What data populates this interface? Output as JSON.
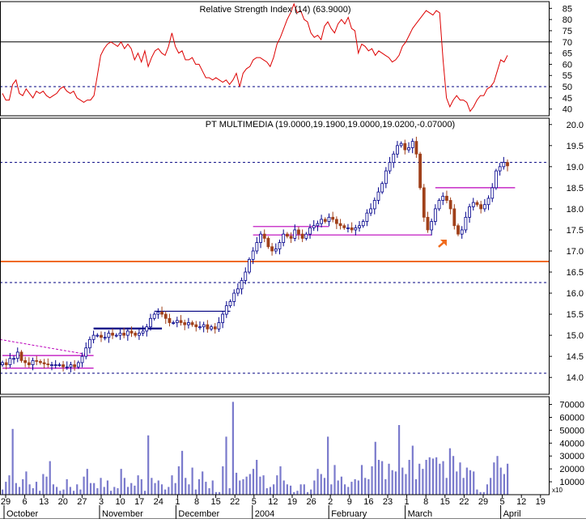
{
  "chart_data": [
    {
      "type": "line",
      "panel": "indicator",
      "title": "Relative Strength Index (14) (63.9000)",
      "y_ticks": [
        40,
        45,
        50,
        55,
        60,
        65,
        70,
        75,
        80,
        85
      ],
      "ylim": [
        37,
        88
      ],
      "reference_lines": [
        {
          "y": 70,
          "style": "solid"
        },
        {
          "y": 50,
          "style": "dashed"
        }
      ],
      "series": [
        {
          "color": "#dd0000",
          "values": [
            47,
            44,
            44,
            51,
            53,
            47,
            46,
            49,
            47,
            45,
            48,
            47,
            48,
            46,
            45,
            46,
            47,
            49,
            50,
            48,
            47,
            48,
            45,
            44,
            43,
            44,
            44,
            46,
            55,
            64,
            67,
            69,
            70,
            69,
            68,
            70,
            67,
            69,
            67,
            62,
            65,
            61,
            66,
            59,
            63,
            66,
            67,
            65,
            64,
            68,
            74,
            68,
            65,
            66,
            62,
            62,
            63,
            60,
            60,
            57,
            54,
            54,
            53,
            54,
            53,
            52,
            53,
            51,
            53,
            56,
            50,
            56,
            58,
            59,
            62,
            63,
            63,
            62,
            61,
            59,
            63,
            69,
            72,
            76,
            80,
            83,
            87,
            83,
            84,
            80,
            79,
            74,
            72,
            73,
            71,
            77,
            79,
            76,
            74,
            78,
            80,
            78,
            81,
            76,
            75,
            65,
            69,
            68,
            66,
            67,
            64,
            66,
            65,
            64,
            63,
            61,
            62,
            64,
            68,
            70,
            73,
            76,
            78,
            80,
            82,
            84,
            83,
            82,
            84,
            83,
            62,
            45,
            41,
            44,
            46,
            44,
            44,
            43,
            39,
            41,
            44,
            46,
            46,
            49,
            50,
            52,
            57,
            62,
            61,
            64
          ]
        }
      ]
    },
    {
      "type": "candlestick",
      "panel": "price",
      "title": "PT MULTIMEDIA (19.0000,19.1900,19.0000,19.0200,-0.07000)",
      "y_ticks": [
        14.0,
        14.5,
        15.0,
        15.5,
        16.0,
        16.5,
        17.0,
        17.5,
        18.0,
        18.5,
        19.0,
        19.5,
        20.0
      ],
      "ylim": [
        13.6,
        20.15
      ],
      "reference_lines": [
        {
          "y": 16.75,
          "style": "thick",
          "color": "#f06a1c"
        },
        {
          "y": 19.1,
          "style": "dashed"
        },
        {
          "y": 16.25,
          "style": "dashed"
        },
        {
          "y": 14.1,
          "style": "dashed"
        }
      ],
      "close": [
        14.35,
        14.3,
        14.45,
        14.45,
        14.6,
        14.4,
        14.35,
        14.3,
        14.4,
        14.38,
        14.35,
        14.32,
        14.3,
        14.3,
        14.3,
        14.3,
        14.25,
        14.25,
        14.3,
        14.25,
        14.35,
        14.5,
        14.7,
        14.9,
        15.0,
        15.0,
        14.95,
        14.95,
        15.05,
        15.0,
        15.0,
        15.05,
        15.0,
        15.1,
        15.05,
        15.0,
        15.05,
        15.1,
        15.2,
        15.4,
        15.5,
        15.55,
        15.5,
        15.4,
        15.3,
        15.3,
        15.35,
        15.3,
        15.25,
        15.3,
        15.25,
        15.2,
        15.2,
        15.25,
        15.15,
        15.2,
        15.15,
        15.3,
        15.5,
        15.7,
        15.8,
        16.0,
        16.1,
        16.3,
        16.5,
        16.8,
        17.0,
        17.2,
        17.4,
        17.3,
        17.1,
        17.0,
        17.05,
        17.2,
        17.4,
        17.35,
        17.3,
        17.5,
        17.4,
        17.3,
        17.4,
        17.55,
        17.6,
        17.65,
        17.75,
        17.7,
        17.8,
        17.75,
        17.65,
        17.6,
        17.55,
        17.55,
        17.5,
        17.55,
        17.6,
        17.7,
        17.9,
        18.0,
        18.2,
        18.4,
        18.6,
        18.9,
        19.1,
        19.3,
        19.5,
        19.55,
        19.4,
        19.45,
        19.6,
        19.3,
        18.5,
        17.8,
        17.5,
        17.7,
        18.0,
        18.2,
        18.3,
        18.2,
        18.0,
        17.6,
        17.4,
        17.5,
        17.8,
        18.05,
        18.15,
        18.1,
        18.0,
        18.1,
        18.25,
        18.5,
        18.9,
        19.0,
        19.1,
        19.02
      ],
      "annotations": [
        {
          "shape": "line",
          "from": [
            14.22,
            14.22
          ],
          "color": "#bb00bb"
        },
        {
          "shape": "line",
          "y": 15.15,
          "color": "#000080"
        },
        {
          "shape": "line",
          "y": 15.55,
          "color": "#000080"
        },
        {
          "shape": "line",
          "y": 17.58,
          "color": "#bb00bb"
        },
        {
          "shape": "line",
          "y": 17.38,
          "color": "#bb00bb"
        },
        {
          "shape": "line",
          "y": 18.5,
          "color": "#bb00bb"
        },
        {
          "shape": "arrow",
          "color": "#f06a1c"
        }
      ]
    },
    {
      "type": "bar",
      "panel": "volume",
      "y_ticks": [
        10000,
        20000,
        30000,
        40000,
        50000,
        60000,
        70000
      ],
      "ylim": [
        0,
        76000
      ],
      "color": "#7a7acc",
      "values": [
        4000,
        10000,
        15000,
        51000,
        9000,
        6000,
        12000,
        18000,
        8000,
        5000,
        10000,
        3000,
        16000,
        14000,
        26000,
        8000,
        6000,
        3000,
        4000,
        12000,
        6000,
        3000,
        8000,
        4000,
        14000,
        20000,
        9000,
        9000,
        5000,
        13000,
        6000,
        11000,
        3000,
        6000,
        5000,
        20000,
        13000,
        6000,
        9000,
        7000,
        15000,
        12000,
        3000,
        46000,
        13000,
        9000,
        11000,
        8000,
        4000,
        6000,
        15000,
        9000,
        22000,
        34000,
        13000,
        8000,
        21000,
        4000,
        12000,
        18000,
        10000,
        5000,
        11000,
        2000,
        2000,
        22000,
        45000,
        5000,
        72000,
        17000,
        11000,
        12000,
        14000,
        16000,
        20000,
        27000,
        14000,
        15000,
        5000,
        6000,
        8000,
        15000,
        22000,
        11000,
        8000,
        7000,
        2000,
        3000,
        8000,
        8000,
        2000,
        4000,
        11000,
        20000,
        16000,
        13000,
        45000,
        8000,
        23000,
        11000,
        14000,
        8000,
        6000,
        10000,
        12000,
        11000,
        23000,
        13000,
        12000,
        22000,
        41000,
        27000,
        26000,
        12000,
        24000,
        19000,
        18000,
        54000,
        21000,
        16000,
        27000,
        38000,
        12000,
        24000,
        20000,
        27000,
        29000,
        28000,
        29000,
        24000,
        26000,
        13000,
        36000,
        30000,
        18000,
        25000,
        13000,
        21000,
        19000,
        18000,
        4000,
        2000,
        2000,
        8000,
        13000,
        25000,
        30000,
        21000,
        16000,
        24000
      ]
    }
  ],
  "x_axis": {
    "tick_labels": [
      "29",
      "6",
      "13",
      "20",
      "27",
      "3",
      "10",
      "17",
      "24",
      "1",
      "8",
      "15",
      "22",
      "5",
      "12",
      "19",
      "26",
      "2",
      "9",
      "16",
      "23",
      "1",
      "8",
      "15",
      "22",
      "29",
      "5",
      "12",
      "19"
    ],
    "month_labels": [
      "October",
      "November",
      "December",
      "2004",
      "February",
      "March",
      "April"
    ]
  },
  "corner_label": "x10"
}
